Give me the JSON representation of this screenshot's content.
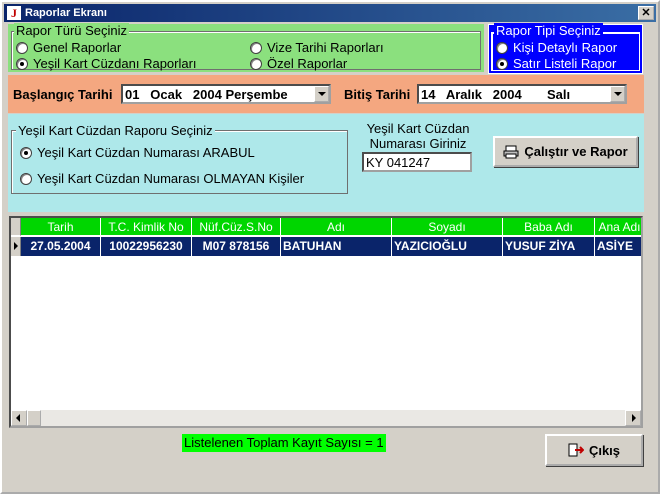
{
  "window": {
    "title": "Raporlar Ekranı",
    "icon": "app-icon",
    "close_label": "✕"
  },
  "report_type": {
    "title": "Rapor  Türü  Seçiniz",
    "options": [
      {
        "label": "Genel Raporlar",
        "checked": false
      },
      {
        "label": "Yeşil Kart Cüzdanı Raporları",
        "checked": true
      },
      {
        "label": "Vize Tarihi Raporları",
        "checked": false
      },
      {
        "label": "Özel Raporlar",
        "checked": false
      }
    ]
  },
  "report_kind": {
    "title": "Rapor Tipi Seçiniz",
    "options": [
      {
        "label": "Kişi Detaylı Rapor",
        "checked": false
      },
      {
        "label": "Satır Listeli Rapor",
        "checked": true
      }
    ]
  },
  "dates": {
    "start_label": "Başlangıç Tarihi",
    "start_value": "01   Ocak   2004 Perşembe",
    "end_label": "Bitiş Tarihi",
    "end_value": "14   Aralık   2004       Salı"
  },
  "card_report": {
    "title": "Yeşil Kart Cüzdan Raporu Seçiniz",
    "options": [
      {
        "label": "Yeşil Kart Cüzdan Numarası ARABUL",
        "checked": true
      },
      {
        "label": "Yeşil Kart Cüzdan Numarası OLMAYAN Kişiler",
        "checked": false
      }
    ],
    "input_label_line1": "Yeşil Kart Cüzdan",
    "input_label_line2": "Numarası Giriniz",
    "input_value": "KY 041247",
    "run_button": "Çalıştır ve Rapor",
    "run_icon": "printer-icon"
  },
  "grid": {
    "columns": [
      "Tarih",
      "T.C. Kimlik No",
      "Nüf.Cüz.S.No",
      "Adı",
      "Soyadı",
      "Baba Adı",
      "Ana Adı"
    ],
    "rows": [
      [
        "27.05.2004",
        "10022956230",
        "M07 878156",
        "BATUHAN",
        "YAZICIOĞLU",
        "YUSUF ZİYA",
        "ASİYE"
      ]
    ]
  },
  "status": {
    "text": "Listelenen Toplam Kayıt Sayısı = 1"
  },
  "exit_button": {
    "label": "Çıkış",
    "icon": "exit-door-icon"
  },
  "colors": {
    "green_panel": "#8be07e",
    "blue_panel": "#0000ff",
    "salmon_panel": "#f4a780",
    "cyan_panel": "#aee8ea",
    "grid_header": "#00d600",
    "selected_row": "#0a246a",
    "status_bg": "#00ff00"
  }
}
